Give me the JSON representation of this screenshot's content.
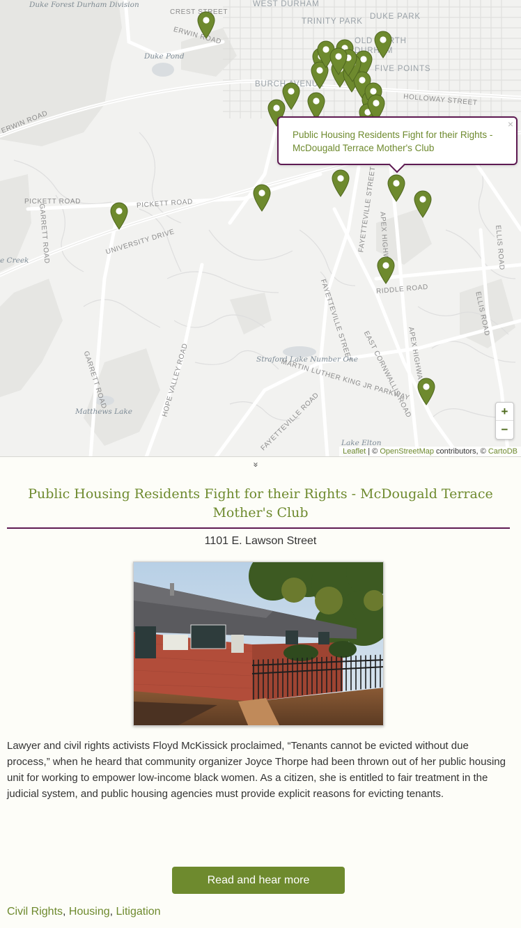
{
  "map": {
    "labels": {
      "duke_forest": "Duke Forest Durham Division",
      "crest_street": "CREST STREET",
      "west_durham": "WEST DURHAM",
      "trinity_park": "TRINITY PARK",
      "duke_park": "DUKE PARK",
      "old_north_durham": "OLD NORTH DURHAM",
      "erwin_road_top": "ERWIN ROAD",
      "duke_pond": "Duke Pond",
      "burch_avenue": "BURCH AVENUE",
      "five_points": "FIVE POINTS",
      "holloway_street": "HOLLOWAY STREET",
      "erwin_road_left": "ERWIN ROAD",
      "pickett_road_left": "PICKETT ROAD",
      "pickett_road_mid": "PICKETT ROAD",
      "university_drive": "UNIVERSITY DRIVE",
      "garrett_road_top": "GARRETT ROAD",
      "creek": "e Creek",
      "fayetteville_street_top": "FAYETTEVILLE STREET",
      "apex_highway_top": "APEX HIGHWAY",
      "ellis_road": "ELLIS ROAD",
      "riddle_road": "RIDDLE ROAD",
      "fayetteville_street_mid": "FAYETTEVILLE STREET",
      "east_cornwallis_road": "EAST CORNWALLIS ROAD",
      "straford_lake": "Straford Lake Number One",
      "mlk_parkway": "MARTIN LUTHER KING JR PARKWAY",
      "garrett_road_bottom": "GARRETT ROAD",
      "hope_valley_road": "HOPE VALLEY ROAD",
      "matthews_lake": "Matthews Lake",
      "fayetteville_road": "FAYETTEVILLE ROAD",
      "apex_highway_bottom": "APEX HIGHWAY",
      "lake_elton": "Lake Elton",
      "ellis_road_right": "ELLIS ROAD"
    },
    "marker_color": "#6e8a2e",
    "marker_count": 27,
    "popup": {
      "text": "Public Housing Residents Fight for their Rights - McDougald Terrace Mother's Club",
      "close": "×"
    },
    "zoom": {
      "in": "+",
      "out": "−"
    },
    "attribution": {
      "leaflet": "Leaflet",
      "separator1": " | © ",
      "osm": "OpenStreetMap",
      "contributors": " contributors, © ",
      "cartodb": "CartoDB"
    }
  },
  "detail": {
    "toggle": "»",
    "title": "Public Housing Residents Fight for their Rights - McDougald Terrace Mother's Club",
    "address": "1101 E. Lawson Street",
    "description": "Lawyer and civil rights activists Floyd McKissick proclaimed, “Tenants cannot be evicted without due process,” when he heard that community organizer Joyce Thorpe had been thrown out of her public housing unit for working to empower low-income black women. As a citizen, she is entitled to fair treatment in the judicial system, and public housing agencies must provide explicit reasons for evicting tenants.",
    "read_more": "Read and hear more",
    "tags": [
      "Civil Rights",
      "Housing",
      "Litigation"
    ],
    "tag_separator": ", "
  },
  "colors": {
    "accent_green": "#6e8a2e",
    "accent_purple": "#5e1a52"
  }
}
